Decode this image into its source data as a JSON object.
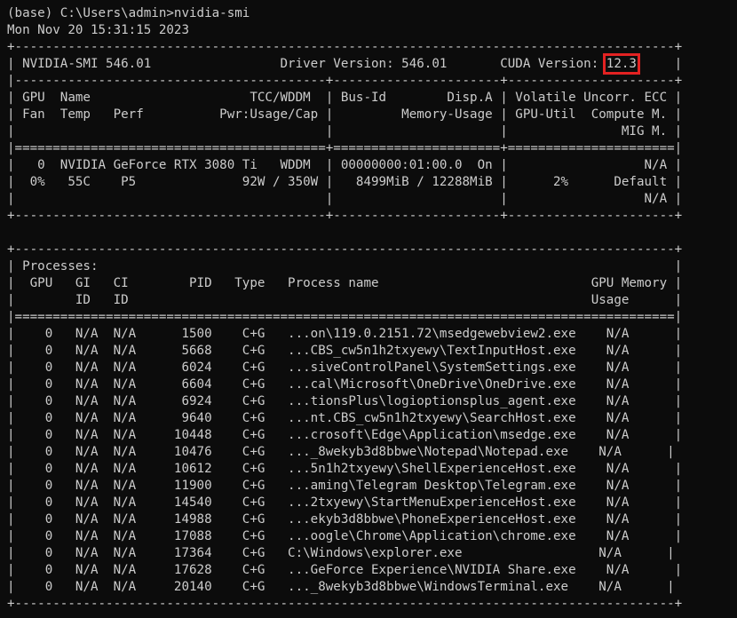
{
  "terminal": {
    "prompt_line": "(base) C:\\Users\\admin>nvidia-smi",
    "timestamp": "Mon Nov 20 15:31:15 2023",
    "header": {
      "border_top": "+---------------------------------------------------------------------------------------+",
      "smi_prefix": "| NVIDIA-SMI 546.01                 Driver Version: 546.01       CUDA Version: ",
      "cuda_version": "12.3",
      "smi_suffix": "     |",
      "divider": "|-----------------------------------------+----------------------+----------------------+",
      "col_row_1": "| GPU  Name                     TCC/WDDM  | Bus-Id        Disp.A | Volatile Uncorr. ECC |",
      "col_row_2": "| Fan  Temp   Perf          Pwr:Usage/Cap |         Memory-Usage | GPU-Util  Compute M. |",
      "col_row_3": "|                                         |                      |               MIG M. |",
      "double_divider": "|=========================================+======================+======================|"
    },
    "gpu": {
      "row_1": "|   0  NVIDIA GeForce RTX 3080 Ti   WDDM  | 00000000:01:00.0  On |                  N/A |",
      "row_2": "|  0%   55C    P5              92W / 350W |   8499MiB / 12288MiB |      2%      Default |",
      "row_3": "|                                         |                      |                  N/A |",
      "border_bottom": "+-----------------------------------------+----------------------+----------------------+"
    },
    "processes": {
      "border_top": "+---------------------------------------------------------------------------------------+",
      "title": "| Processes:                                                                            |",
      "col_row_1": "|  GPU   GI   CI        PID   Type   Process name                            GPU Memory |",
      "col_row_2": "|        ID   ID                                                             Usage      |",
      "double_divider": "|=======================================================================================|",
      "rows": [
        "|    0   N/A  N/A      1500    C+G   ...on\\119.0.2151.72\\msedgewebview2.exe    N/A      |",
        "|    0   N/A  N/A      5668    C+G   ...CBS_cw5n1h2txyewy\\TextInputHost.exe    N/A      |",
        "|    0   N/A  N/A      6024    C+G   ...siveControlPanel\\SystemSettings.exe    N/A      |",
        "|    0   N/A  N/A      6604    C+G   ...cal\\Microsoft\\OneDrive\\OneDrive.exe    N/A      |",
        "|    0   N/A  N/A      6924    C+G   ...tionsPlus\\logioptionsplus_agent.exe    N/A      |",
        "|    0   N/A  N/A      9640    C+G   ...nt.CBS_cw5n1h2txyewy\\SearchHost.exe    N/A      |",
        "|    0   N/A  N/A     10448    C+G   ...crosoft\\Edge\\Application\\msedge.exe    N/A      |",
        "|    0   N/A  N/A     10476    C+G   ..._8wekyb3d8bbwe\\Notepad\\Notepad.exe    N/A      |",
        "|    0   N/A  N/A     10612    C+G   ...5n1h2txyewy\\ShellExperienceHost.exe    N/A      |",
        "|    0   N/A  N/A     11900    C+G   ...aming\\Telegram Desktop\\Telegram.exe    N/A      |",
        "|    0   N/A  N/A     14540    C+G   ...2txyewy\\StartMenuExperienceHost.exe    N/A      |",
        "|    0   N/A  N/A     14988    C+G   ...ekyb3d8bbwe\\PhoneExperienceHost.exe    N/A      |",
        "|    0   N/A  N/A     17088    C+G   ...oogle\\Chrome\\Application\\chrome.exe    N/A      |",
        "|    0   N/A  N/A     17364    C+G   C:\\Windows\\explorer.exe                  N/A      |",
        "|    0   N/A  N/A     17628    C+G   ...GeForce Experience\\NVIDIA Share.exe    N/A      |",
        "|    0   N/A  N/A     20140    C+G   ..._8wekyb3d8bbwe\\WindowsTerminal.exe    N/A      |"
      ],
      "border_bottom": "+---------------------------------------------------------------------------------------+"
    }
  }
}
